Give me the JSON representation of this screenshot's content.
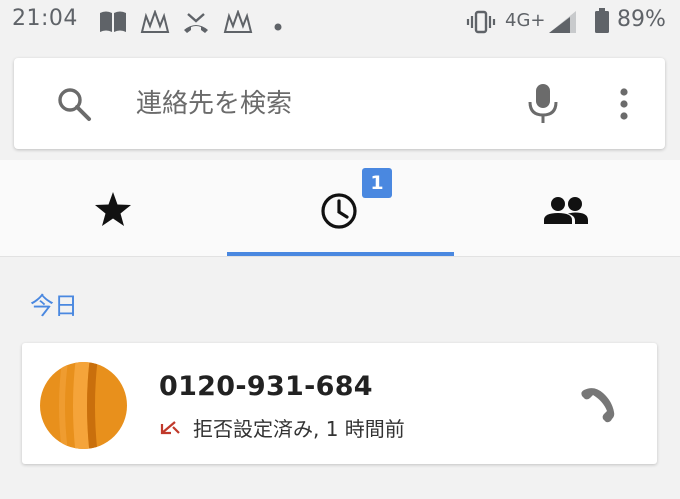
{
  "status_bar": {
    "time": "21:04",
    "network": "4G+",
    "battery": "89%"
  },
  "search": {
    "placeholder": "連絡先を検索",
    "value": ""
  },
  "tabs": [
    {
      "icon": "star-icon",
      "selected": false
    },
    {
      "icon": "clock-icon",
      "selected": true,
      "badge": "1"
    },
    {
      "icon": "people-icon",
      "selected": false
    }
  ],
  "section": {
    "label": "今日"
  },
  "call_log": [
    {
      "number": "0120-931-684",
      "status": "拒否設定済み, 1 時間前",
      "status_icon": "blocked-call-icon"
    }
  ],
  "colors": {
    "accent": "#4a88e0",
    "avatar": "#e8901c",
    "blocked": "#c0392b"
  }
}
